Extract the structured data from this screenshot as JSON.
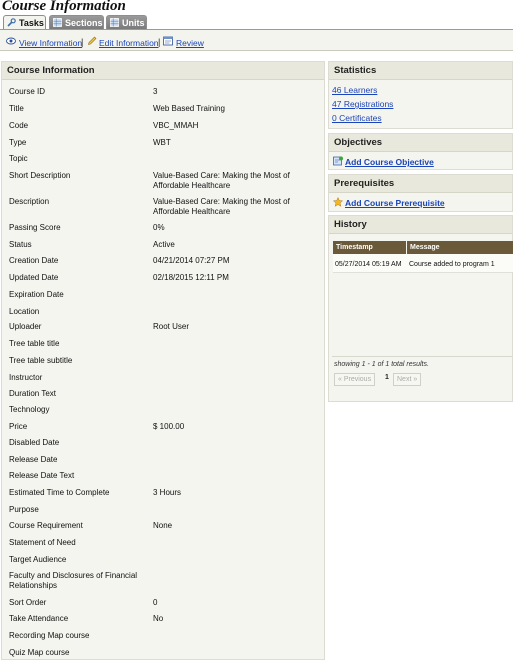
{
  "page_title": "Course Information",
  "tabs": [
    {
      "label": "Tasks",
      "active": true,
      "icon": "wrench-icon"
    },
    {
      "label": "Sections",
      "active": false,
      "icon": "grid-icon"
    },
    {
      "label": "Units",
      "active": false,
      "icon": "grid-icon"
    }
  ],
  "actions": {
    "view_label": "View Information",
    "edit_label": "Edit Information",
    "review_label": "Review",
    "separator": "|"
  },
  "course_info": {
    "heading": "Course Information",
    "rows": [
      {
        "label": "Course ID",
        "value": "3"
      },
      {
        "label": "Title",
        "value": "Web Based Training"
      },
      {
        "label": "Code",
        "value": "VBC_MMAH"
      },
      {
        "label": "Type",
        "value": "WBT"
      },
      {
        "label": "Topic",
        "value": ""
      },
      {
        "label": "Short Description",
        "value": "Value-Based Care: Making the Most of Affordable Healthcare"
      },
      {
        "label": "Description",
        "value": "Value-Based Care: Making the Most of Affordable Healthcare"
      },
      {
        "label": "Passing Score",
        "value": "0%"
      },
      {
        "label": "Status",
        "value": "Active"
      },
      {
        "label": "Creation Date",
        "value": "04/21/2014 07:27 PM"
      },
      {
        "label": "Updated Date",
        "value": "02/18/2015 12:11 PM"
      },
      {
        "label": "Expiration Date",
        "value": ""
      },
      {
        "label": "Location",
        "value": ""
      },
      {
        "label": "Uploader",
        "value": "Root User"
      },
      {
        "label": "Tree table title",
        "value": ""
      },
      {
        "label": "Tree table subtitle",
        "value": ""
      },
      {
        "label": "Instructor",
        "value": ""
      },
      {
        "label": "Duration Text",
        "value": ""
      },
      {
        "label": "Technology",
        "value": ""
      },
      {
        "label": "Price",
        "value": "$ 100.00"
      },
      {
        "label": "Disabled Date",
        "value": ""
      },
      {
        "label": "Release Date",
        "value": ""
      },
      {
        "label": "Release Date Text",
        "value": ""
      },
      {
        "label": "Estimated Time to Complete",
        "value": "3 Hours"
      },
      {
        "label": "Purpose",
        "value": ""
      },
      {
        "label": "Course Requirement",
        "value": "None"
      },
      {
        "label": "Statement of Need",
        "value": ""
      },
      {
        "label": "Target Audience",
        "value": ""
      },
      {
        "label": "Faculty and Disclosures of Financial Relationships",
        "value": ""
      },
      {
        "label": "Sort Order",
        "value": "0"
      },
      {
        "label": "Take Attendance",
        "value": "No"
      },
      {
        "label": "Recording Map course",
        "value": ""
      },
      {
        "label": "Quiz Map course",
        "value": ""
      }
    ]
  },
  "statistics": {
    "heading": "Statistics",
    "learners": "46 Learners",
    "registrations": "47 Registrations",
    "certificates": "0 Certificates"
  },
  "objectives": {
    "heading": "Objectives",
    "add_label": "Add Course Objective"
  },
  "prerequisites": {
    "heading": "Prerequisites",
    "add_label": "Add Course Prerequisite"
  },
  "history": {
    "heading": "History",
    "columns": [
      "Timestamp",
      "Message"
    ],
    "rows": [
      {
        "timestamp": "05/27/2014 05:19 AM",
        "message": "Course added to program 1"
      }
    ],
    "summary": "showing 1 - 1 of 1 total results.",
    "prev_label": "« Previous",
    "page": "1",
    "next_label": "Next »"
  },
  "colors": {
    "link": "#1a44b8",
    "panel_bg": "#f5f5f0",
    "header_bg": "#e8e8dc",
    "table_header": "#6b5a3a"
  }
}
